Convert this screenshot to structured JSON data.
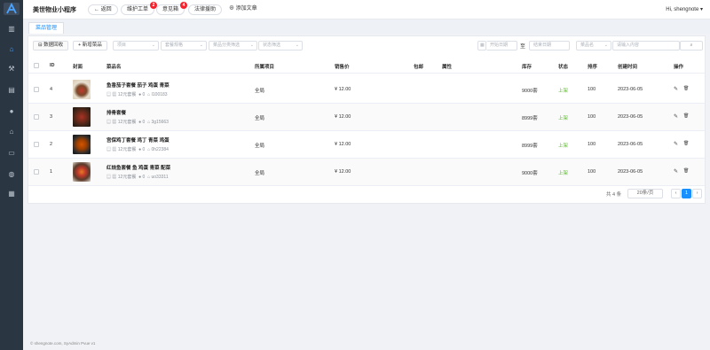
{
  "sidebar": {
    "icons": [
      "chart-icon",
      "home-icon",
      "tool-icon",
      "calculator-icon",
      "list-icon",
      "user-icon",
      "store-icon",
      "mail-icon",
      "chat-icon",
      "calendar-icon"
    ]
  },
  "header": {
    "app_title": "美世物业小程序",
    "nav": [
      {
        "label": "← 返回",
        "badge": ""
      },
      {
        "label": "维护工单",
        "badge": "2"
      },
      {
        "label": "意见箱",
        "badge": "4"
      },
      {
        "label": "法律援助",
        "badge": ""
      },
      {
        "label": "⊕ 添加文章",
        "badge": ""
      }
    ],
    "user": "Hi, shengnote",
    "user_caret": "▾"
  },
  "tab": {
    "label": "菜品管理"
  },
  "toolbar": {
    "recycle_label": "⊟ 数据回收",
    "add_label": "+ 新增菜品",
    "filters": [
      "项目",
      "套餐规格",
      "菜品分类筛选",
      "状态筛选"
    ],
    "date_icon": "▦",
    "date_start": "开始日期",
    "date_sep": "至",
    "date_end": "结束日期",
    "search_type": "菜品名",
    "search_placeholder": "请输入内容",
    "search_icon": "⌕"
  },
  "table": {
    "headers": {
      "id": "ID",
      "cover": "封面",
      "name": "菜品名",
      "project": "所属项目",
      "price": "销售价",
      "shipping": "包邮",
      "attr": "属性",
      "stock": "库存",
      "status": "状态",
      "sort": "排序",
      "created": "创建时间",
      "ops": "操作"
    },
    "rows": [
      {
        "id": "4",
        "name": "鱼香茄子套餐 茄子 鸡蛋 青菜",
        "spec": "12元套餐",
        "sales": "0",
        "code": "I100183",
        "project": "全局",
        "price": "¥ 12.00",
        "stock": "9000套",
        "status": "上架",
        "sort": "100",
        "created": "2023-06-05"
      },
      {
        "id": "3",
        "name": "排骨套餐",
        "spec": "12元套餐",
        "sales": "0",
        "code": "3g15663",
        "project": "全局",
        "price": "¥ 12.00",
        "stock": "8999套",
        "status": "上架",
        "sort": "100",
        "created": "2023-06-05"
      },
      {
        "id": "2",
        "name": "宫保鸡丁套餐 鸡丁 青菜 鸡蛋",
        "spec": "12元套餐",
        "sales": "0",
        "code": "0h22384",
        "project": "全局",
        "price": "¥ 12.00",
        "stock": "8999套",
        "status": "上架",
        "sort": "100",
        "created": "2023-06-05"
      },
      {
        "id": "1",
        "name": "红烧鱼套餐 鱼 鸡蛋 青菜 配菜",
        "spec": "12元套餐",
        "sales": "0",
        "code": "uo33311",
        "project": "全局",
        "price": "¥ 12.00",
        "stock": "9000套",
        "status": "上架",
        "sort": "100",
        "created": "2023-06-05"
      }
    ],
    "edit_icon": "✎",
    "delete_icon": "🗑"
  },
  "pagination": {
    "total": "共 4 条",
    "page_size": "20条/页",
    "prev": "‹",
    "current": "1",
    "next": "›"
  },
  "footer": {
    "text": "© shengnote.com, SyAdmin Pvue v1"
  },
  "colors": {
    "sidebar": "#2b3643",
    "accent": "#1890ff",
    "status_on": "#52c41a",
    "badge": "#f5222d"
  }
}
